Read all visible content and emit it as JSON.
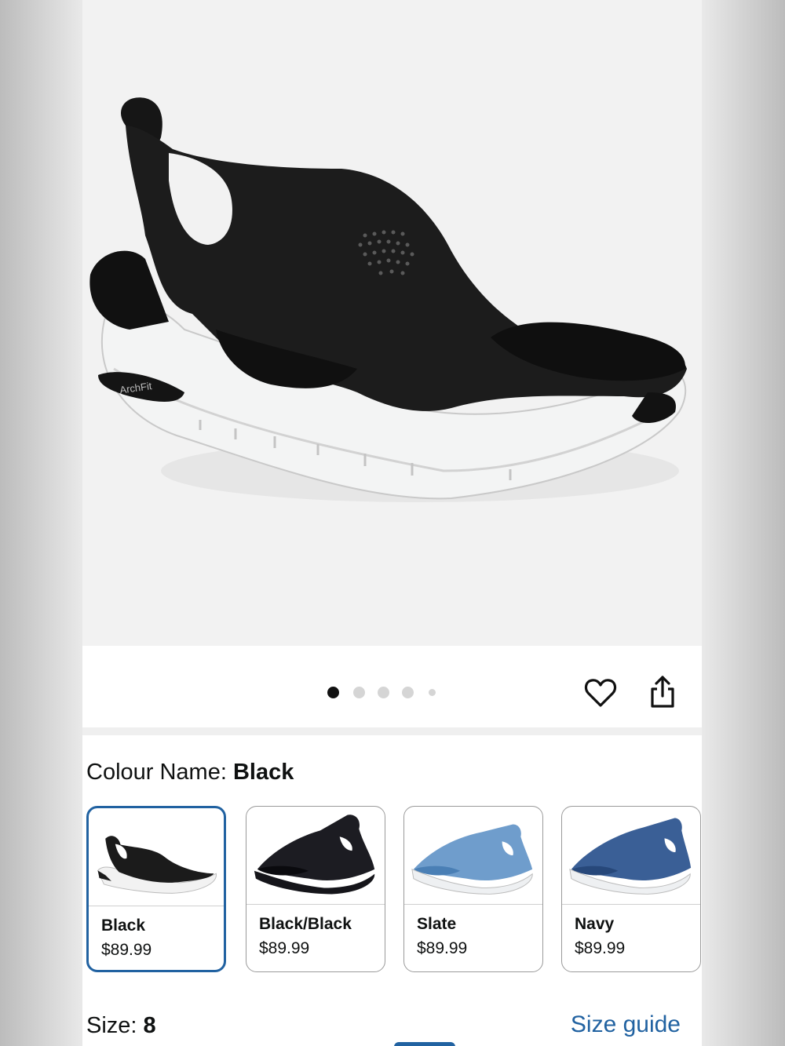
{
  "gallery": {
    "image_alt": "Black knit slingback sandal with white ArchFit sole",
    "sole_text": "ArchFit",
    "dot_count": 5,
    "active_dot": 1
  },
  "actions": {
    "favorite_icon": "heart-icon",
    "share_icon": "share-icon"
  },
  "colour": {
    "label": "Colour Name:",
    "selected": "Black"
  },
  "swatches": [
    {
      "name": "Black",
      "price": "$89.99",
      "upper": "#1b1b1b",
      "sole": "#f0f0f0",
      "selected": true
    },
    {
      "name": "Black/Black",
      "price": "$89.99",
      "upper": "#1c1c22",
      "sole": "#15151a",
      "selected": false
    },
    {
      "name": "Slate",
      "price": "$89.99",
      "upper": "#6f9dcc",
      "sole": "#eef0f2",
      "selected": false
    },
    {
      "name": "Navy",
      "price": "$89.99",
      "upper": "#3a5f96",
      "sole": "#eef0f2",
      "selected": false
    }
  ],
  "size": {
    "label": "Size:",
    "value": "8",
    "guide_link": "Size guide"
  },
  "colors": {
    "accent": "#2162a1",
    "text": "#0f1111"
  }
}
